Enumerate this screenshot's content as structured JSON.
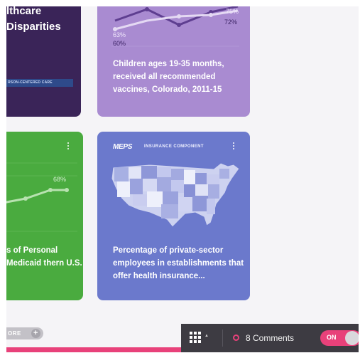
{
  "cards": {
    "healthcare": {
      "title_line1": "lthcare",
      "title_line2": "Disparities",
      "tag": "RSON-CENTERED CARE"
    },
    "vaccines": {
      "values": [
        "75%",
        "72%",
        "63%",
        "60%"
      ],
      "description": "Children ages 19-35 months, received all recommended vaccines, Colorado, 2011-15",
      "line_color": "#5e3e90",
      "accent_color": "#a98bd1"
    },
    "medicaid": {
      "value": "68%",
      "description": "s of Personal Medicaid thern U.S.",
      "accent_color": "#4aab3f"
    },
    "insurance": {
      "brand": "MEPS",
      "component": "INSURANCE COMPONENT",
      "description": "Percentage of private-sector employees in establishments that offer health insurance...",
      "accent_color": "#6b79cc"
    }
  },
  "more_button": {
    "label": "ORE",
    "icon": "plus-icon"
  },
  "toolbar": {
    "apps_icon": "grid-icon",
    "comments_label": "8 Comments",
    "comment_icon": "comment-icon",
    "toggle_label": "ON",
    "toggle_state": "on",
    "toggle_color": "#e8417a"
  }
}
